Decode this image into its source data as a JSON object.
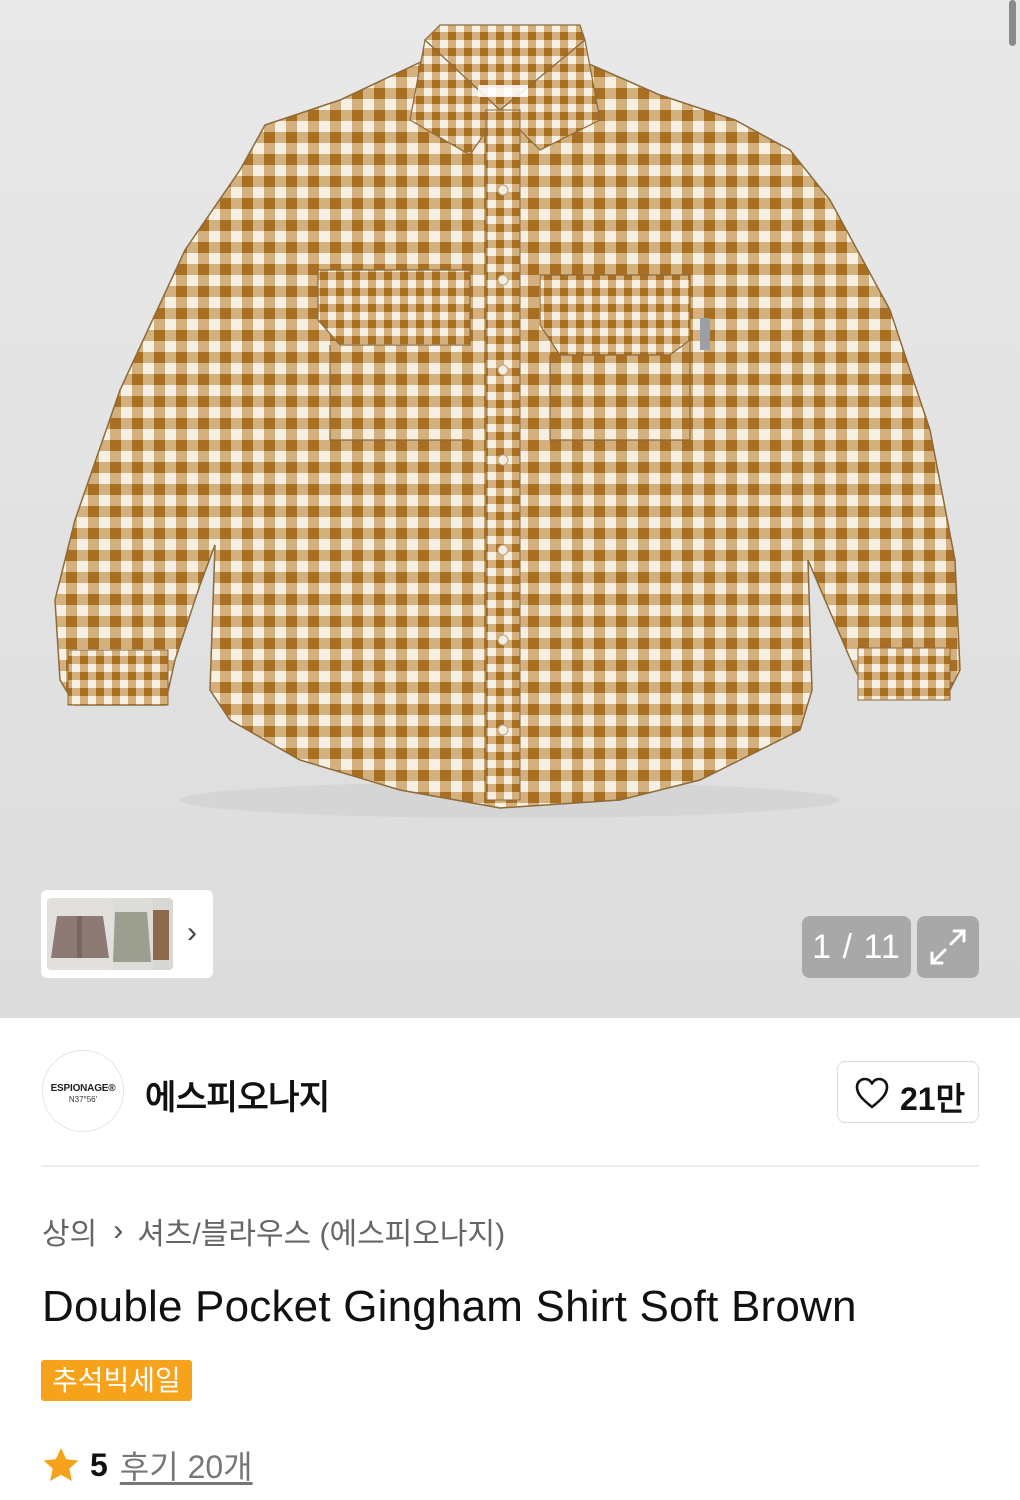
{
  "gallery": {
    "current": "1",
    "total": "11",
    "counter_text": "1 / 11",
    "next_thumbs_icon": "chevron-right-icon",
    "expand_icon": "expand-icon"
  },
  "brand": {
    "logo_line1": "ESPIONAGE®",
    "logo_line2": "N37°56'",
    "name": "에스피오나지",
    "like_count": "21만",
    "like_icon": "heart-outline-icon"
  },
  "breadcrumb": {
    "category": "상의",
    "separator_icon": "chevron-right-icon",
    "subcategory": "셔츠/블라우스 (에스피오나지)"
  },
  "product": {
    "title": "Double Pocket Gingham Shirt Soft Brown",
    "badge": "추석빅세일",
    "rating": "5",
    "review_link": "후기 20개",
    "star_icon": "star-icon"
  },
  "colors": {
    "gingham_dark": "#b07a2e",
    "gingham_light": "#f6efe4",
    "badge": "#f7a21b",
    "star": "#f7a21b"
  }
}
